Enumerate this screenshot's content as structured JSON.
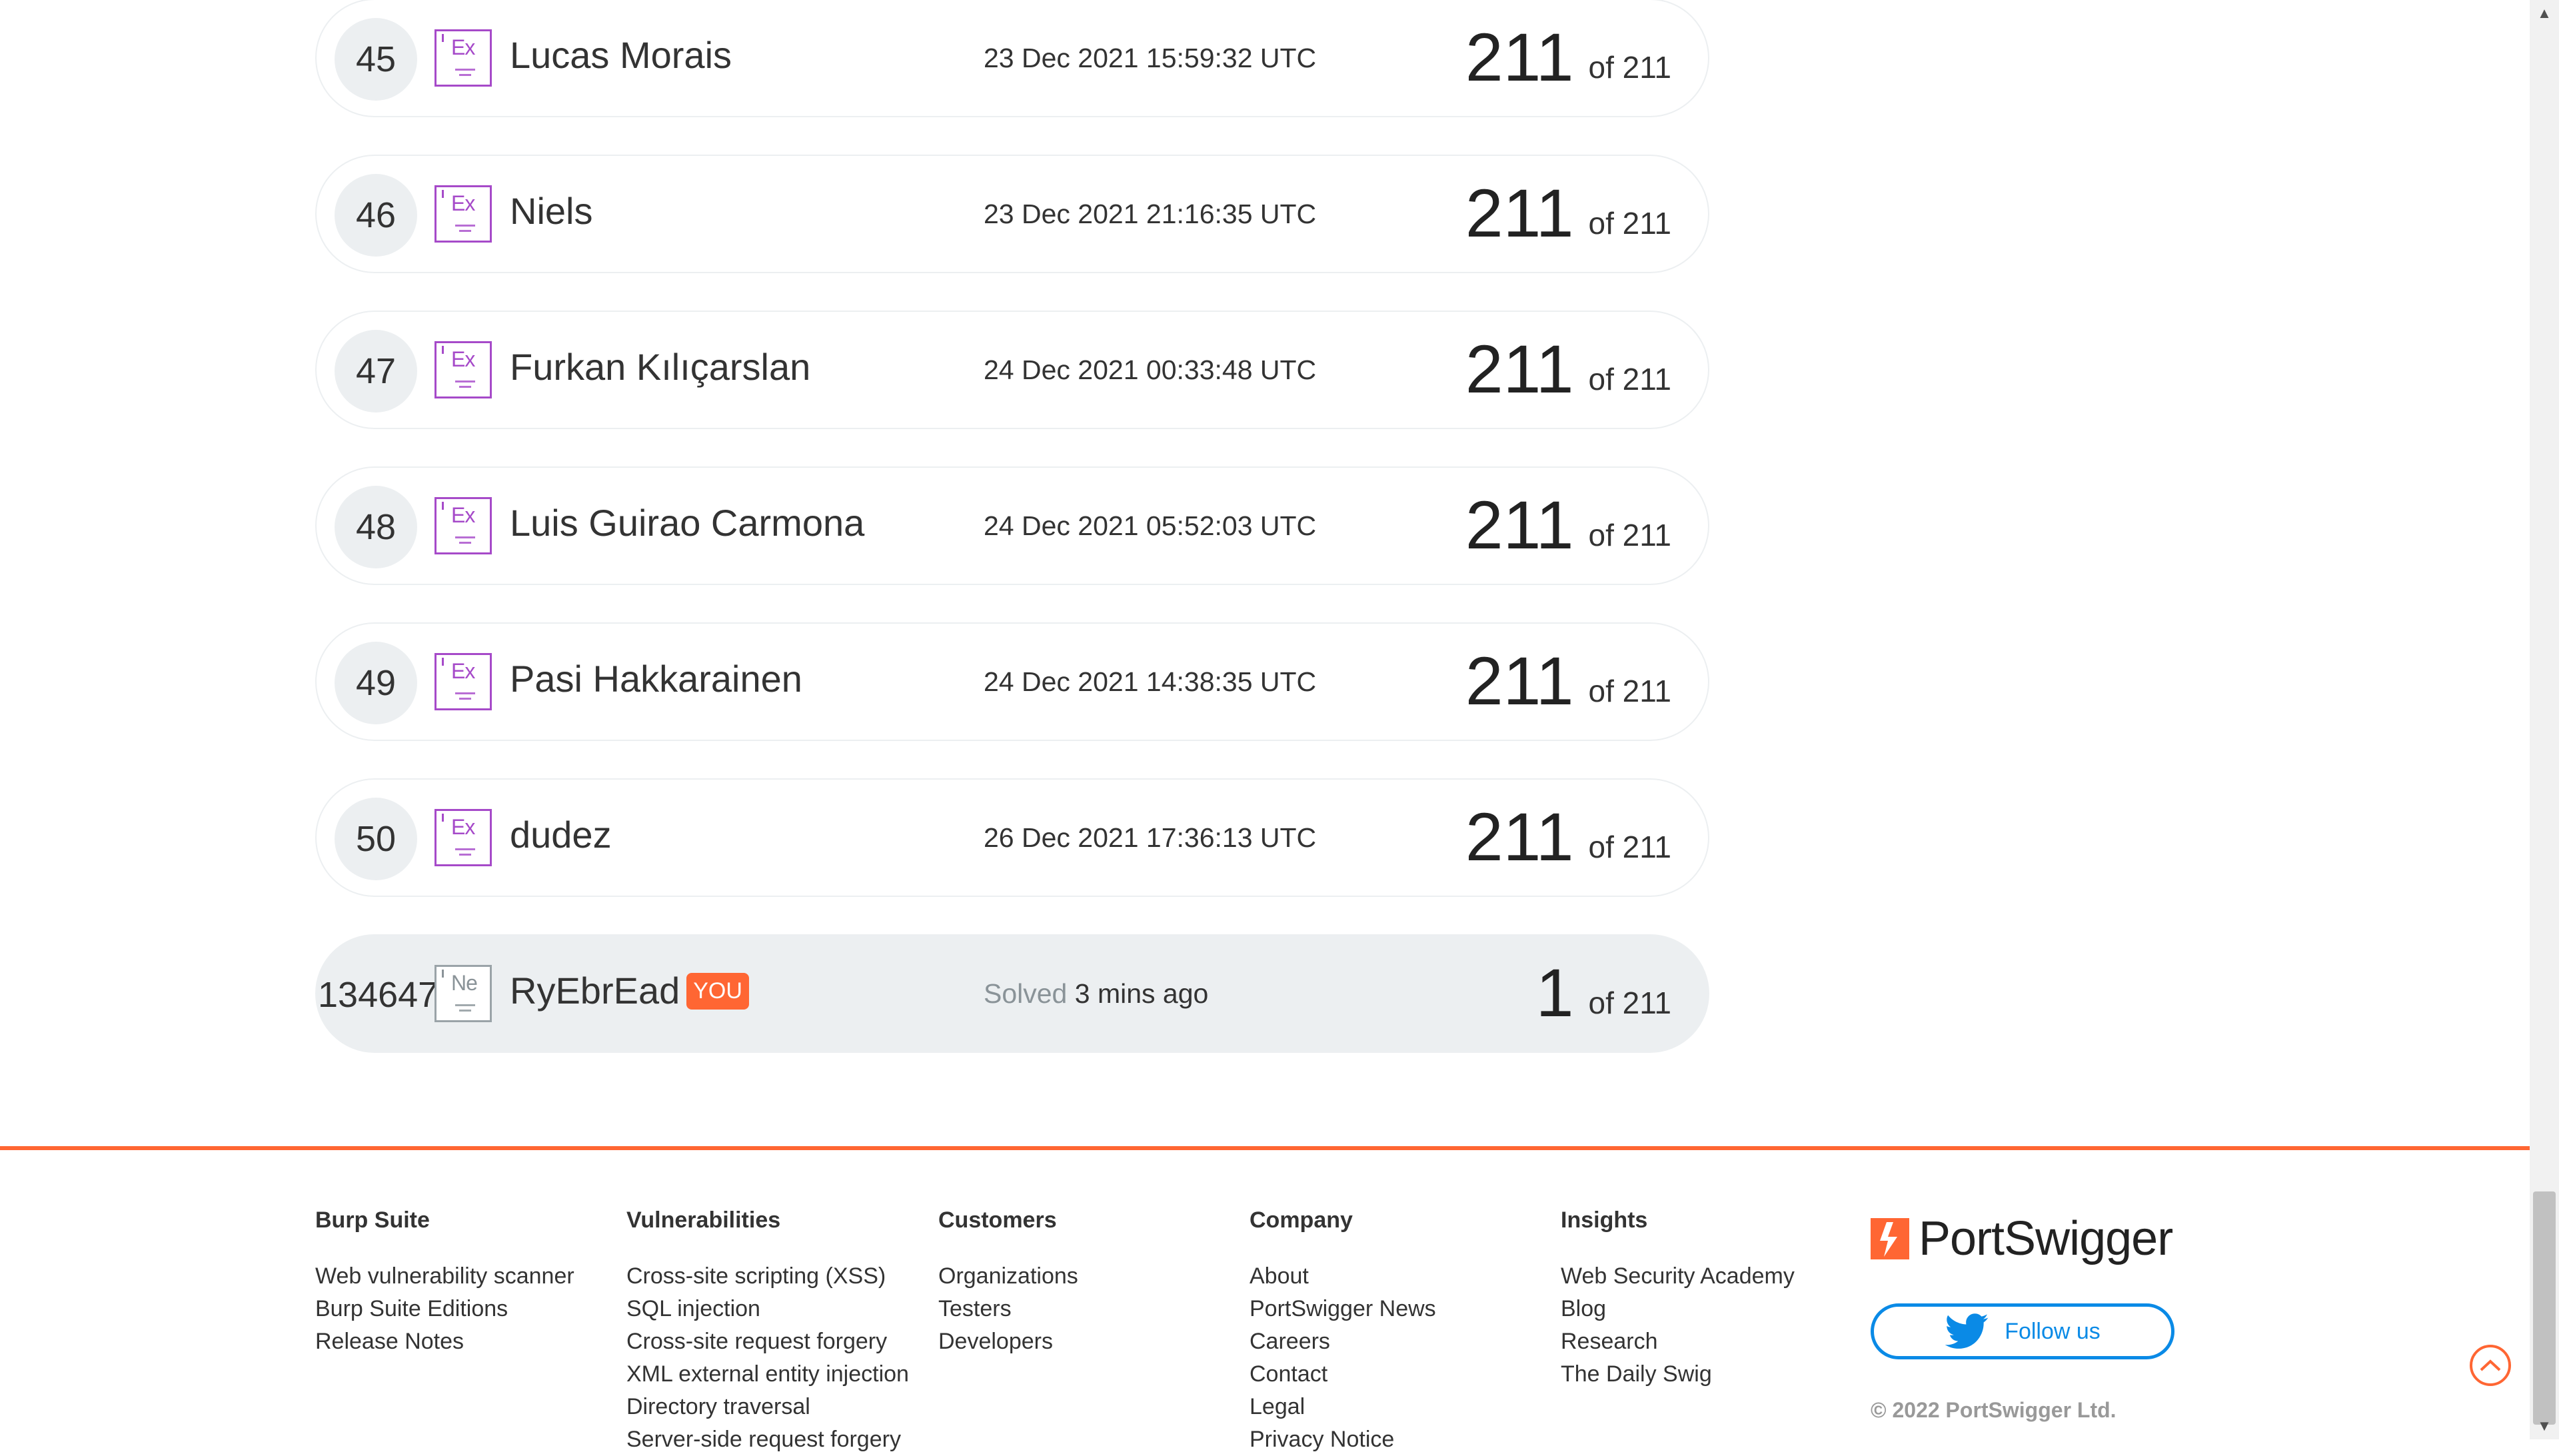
{
  "leaderboard": {
    "rows": [
      {
        "rank": "45",
        "level": "Ex",
        "name": "Lucas Morais",
        "date": "23 Dec 2021 15:59:32 UTC",
        "score": "211",
        "of": "of 211"
      },
      {
        "rank": "46",
        "level": "Ex",
        "name": "Niels",
        "date": "23 Dec 2021 21:16:35 UTC",
        "score": "211",
        "of": "of 211"
      },
      {
        "rank": "47",
        "level": "Ex",
        "name": "Furkan Kılıçarslan",
        "date": "24 Dec 2021 00:33:48 UTC",
        "score": "211",
        "of": "of 211"
      },
      {
        "rank": "48",
        "level": "Ex",
        "name": "Luis Guirao Carmona",
        "date": "24 Dec 2021 05:52:03 UTC",
        "score": "211",
        "of": "of 211"
      },
      {
        "rank": "49",
        "level": "Ex",
        "name": "Pasi Hakkarainen",
        "date": "24 Dec 2021 14:38:35 UTC",
        "score": "211",
        "of": "of 211"
      },
      {
        "rank": "50",
        "level": "Ex",
        "name": "dudez",
        "date": "26 Dec 2021 17:36:13 UTC",
        "score": "211",
        "of": "of 211"
      }
    ],
    "you": {
      "rank": "134647",
      "level": "Ne",
      "name": "RyEbrEad",
      "badge": "YOU",
      "solved_label": "Solved",
      "solved_time": "3 mins ago",
      "score": "1",
      "of": "of 211"
    }
  },
  "footer": {
    "columns": [
      {
        "title": "Burp Suite",
        "links": [
          "Web vulnerability scanner",
          "Burp Suite Editions",
          "Release Notes"
        ]
      },
      {
        "title": "Vulnerabilities",
        "links": [
          "Cross-site scripting (XSS)",
          "SQL injection",
          "Cross-site request forgery",
          "XML external entity injection",
          "Directory traversal",
          "Server-side request forgery"
        ]
      },
      {
        "title": "Customers",
        "links": [
          "Organizations",
          "Testers",
          "Developers"
        ]
      },
      {
        "title": "Company",
        "links": [
          "About",
          "PortSwigger News",
          "Careers",
          "Contact",
          "Legal",
          "Privacy Notice"
        ]
      },
      {
        "title": "Insights",
        "links": [
          "Web Security Academy",
          "Blog",
          "Research",
          "The Daily Swig"
        ]
      }
    ],
    "brand": "PortSwigger",
    "follow_label": "Follow us",
    "copyright": "© 2022 PortSwigger Ltd."
  },
  "colors": {
    "accent": "#ff6633",
    "twitter": "#0a8ae6",
    "expert": "#a64ac9",
    "row_bg": "#eceff1"
  },
  "icons": {
    "level_badge": "level-badge-icon",
    "twitter": "twitter-bird-icon",
    "back_to_top": "chevron-up-icon"
  }
}
